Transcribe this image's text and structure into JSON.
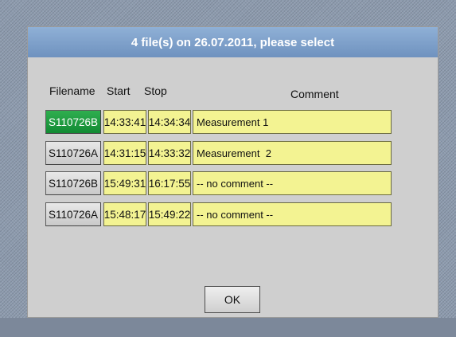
{
  "dialog": {
    "title": "4 file(s) on 26.07.2011, please select",
    "headers": {
      "filename": "Filename",
      "start": "Start",
      "stop": "Stop",
      "comment": "Comment"
    },
    "rows": [
      {
        "filename": "S110726B",
        "start": "14:33:41",
        "stop": "14:34:34",
        "comment": "Measurement 1",
        "selected": true
      },
      {
        "filename": "S110726A",
        "start": "14:31:15",
        "stop": "14:33:32",
        "comment": "Measurement  2",
        "selected": false
      },
      {
        "filename": "S110726B",
        "start": "15:49:31",
        "stop": "16:17:55",
        "comment": "-- no comment --",
        "selected": false
      },
      {
        "filename": "S110726A",
        "start": "15:48:17",
        "stop": "15:49:22",
        "comment": "-- no comment --",
        "selected": false
      }
    ],
    "ok_label": "OK"
  },
  "colors": {
    "title_bar": "#7b9dc9",
    "selected_file": "#1f9a3f",
    "field_yellow": "#f3f392",
    "dialog_bg": "#cfcfcf"
  }
}
